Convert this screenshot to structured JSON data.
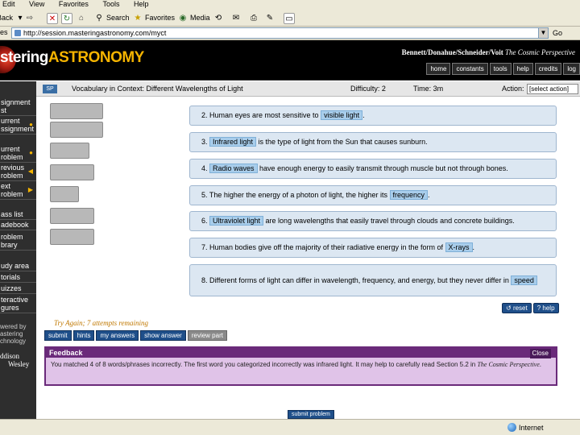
{
  "browser": {
    "menu": [
      "Edit",
      "View",
      "Favorites",
      "Tools",
      "Help"
    ],
    "toolbar": {
      "back": "Back",
      "search": "Search",
      "favorites": "Favorites",
      "media": "Media"
    },
    "address_label": "es",
    "address_url": "http://session.masteringastronomy.com/myct",
    "go_label": "Go",
    "status_zone": "Internet"
  },
  "header": {
    "logo_part1": "stering",
    "logo_part2": "ASTRONOMY",
    "authors": "Bennett/Donahue/Schneider/Voit",
    "book_title": "The Cosmic Perspective",
    "nav": [
      "home",
      "constants",
      "tools",
      "help",
      "credits",
      "log"
    ]
  },
  "sidebar": {
    "items": [
      {
        "label1": "signment",
        "label2": "st"
      },
      {
        "label1": "urrent",
        "label2": "ssignment"
      },
      {
        "label1": "urrent",
        "label2": "roblem"
      },
      {
        "label1": "revious",
        "label2": "roblem"
      },
      {
        "label1": "ext",
        "label2": "roblem"
      },
      {
        "label1": "ass list",
        "label2": ""
      },
      {
        "label1": "adebook",
        "label2": ""
      },
      {
        "label1": "roblem",
        "label2": "brary"
      },
      {
        "label1": "udy area",
        "label2": ""
      },
      {
        "label1": "torials",
        "label2": ""
      },
      {
        "label1": "uizzes",
        "label2": ""
      },
      {
        "label1": "teractive",
        "label2": "gures"
      }
    ],
    "powered_line1": "wered by",
    "powered_line2": "astering",
    "powered_line3": "chnology",
    "publisher_line1": "ddison",
    "publisher_line2": "Wesley"
  },
  "problem": {
    "icon_label": "SP",
    "title": "Vocabulary in Context: Different Wavelengths of Light",
    "difficulty": "Difficulty: 2",
    "time": "Time: 3m",
    "action_label": "Action:",
    "action_value": "[select action]"
  },
  "questions": [
    {
      "before": "2. Human eyes are most sensitive to ",
      "answer": "visible light",
      "after": "."
    },
    {
      "before": "3. ",
      "answer": "Infrared light",
      "after": " is the type of light from the Sun that causes sunburn."
    },
    {
      "before": "4. ",
      "answer": "Radio waves",
      "after": " have enough energy to easily transmit through muscle but not through bones."
    },
    {
      "before": "5. The higher the energy of a photon of light, the higher its ",
      "answer": "frequency",
      "after": "."
    },
    {
      "before": "6. ",
      "answer": "Ultraviolet light",
      "after": " are long wavelengths that easily travel through clouds and concrete buildings."
    },
    {
      "before": "7. Human bodies give off the majority of their radiative energy in the form of ",
      "answer": "X-rays",
      "after": "."
    },
    {
      "before": "8. Different forms of light can differ in wavelength, frequency, and energy, but they never differ in ",
      "answer": "speed",
      "after": ""
    }
  ],
  "controls": {
    "reset": "reset",
    "help": "help",
    "try_again": "Try Again; 7 attempts remaining",
    "buttons": [
      "submit",
      "hints",
      "my answers",
      "show answer",
      "review part"
    ],
    "submit_problem": "submit problem"
  },
  "feedback": {
    "title": "Feedback",
    "close": "Close",
    "text1": "You matched 4 of 8 words/phrases incorrectly. The first word you categorized incorrectly was infrared light. It may help to carefully read Section 5.2 in ",
    "book": "The Cosmic Perspective",
    "text2": "."
  },
  "colors": {
    "answer_fill": "#a8cdeb",
    "question_fill": "#dce7f2",
    "feedback_fill": "#e0c3e8",
    "feedback_header": "#6a2a7a",
    "button_blue": "#1f4f8a",
    "logo_accent": "#f5b400"
  },
  "icons": [
    "back-icon",
    "forward-icon",
    "stop-icon",
    "refresh-icon",
    "home-icon",
    "search-icon",
    "favorites-icon",
    "media-icon",
    "history-icon",
    "mail-icon",
    "print-icon",
    "edit-icon",
    "discuss-icon",
    "globe-icon"
  ]
}
